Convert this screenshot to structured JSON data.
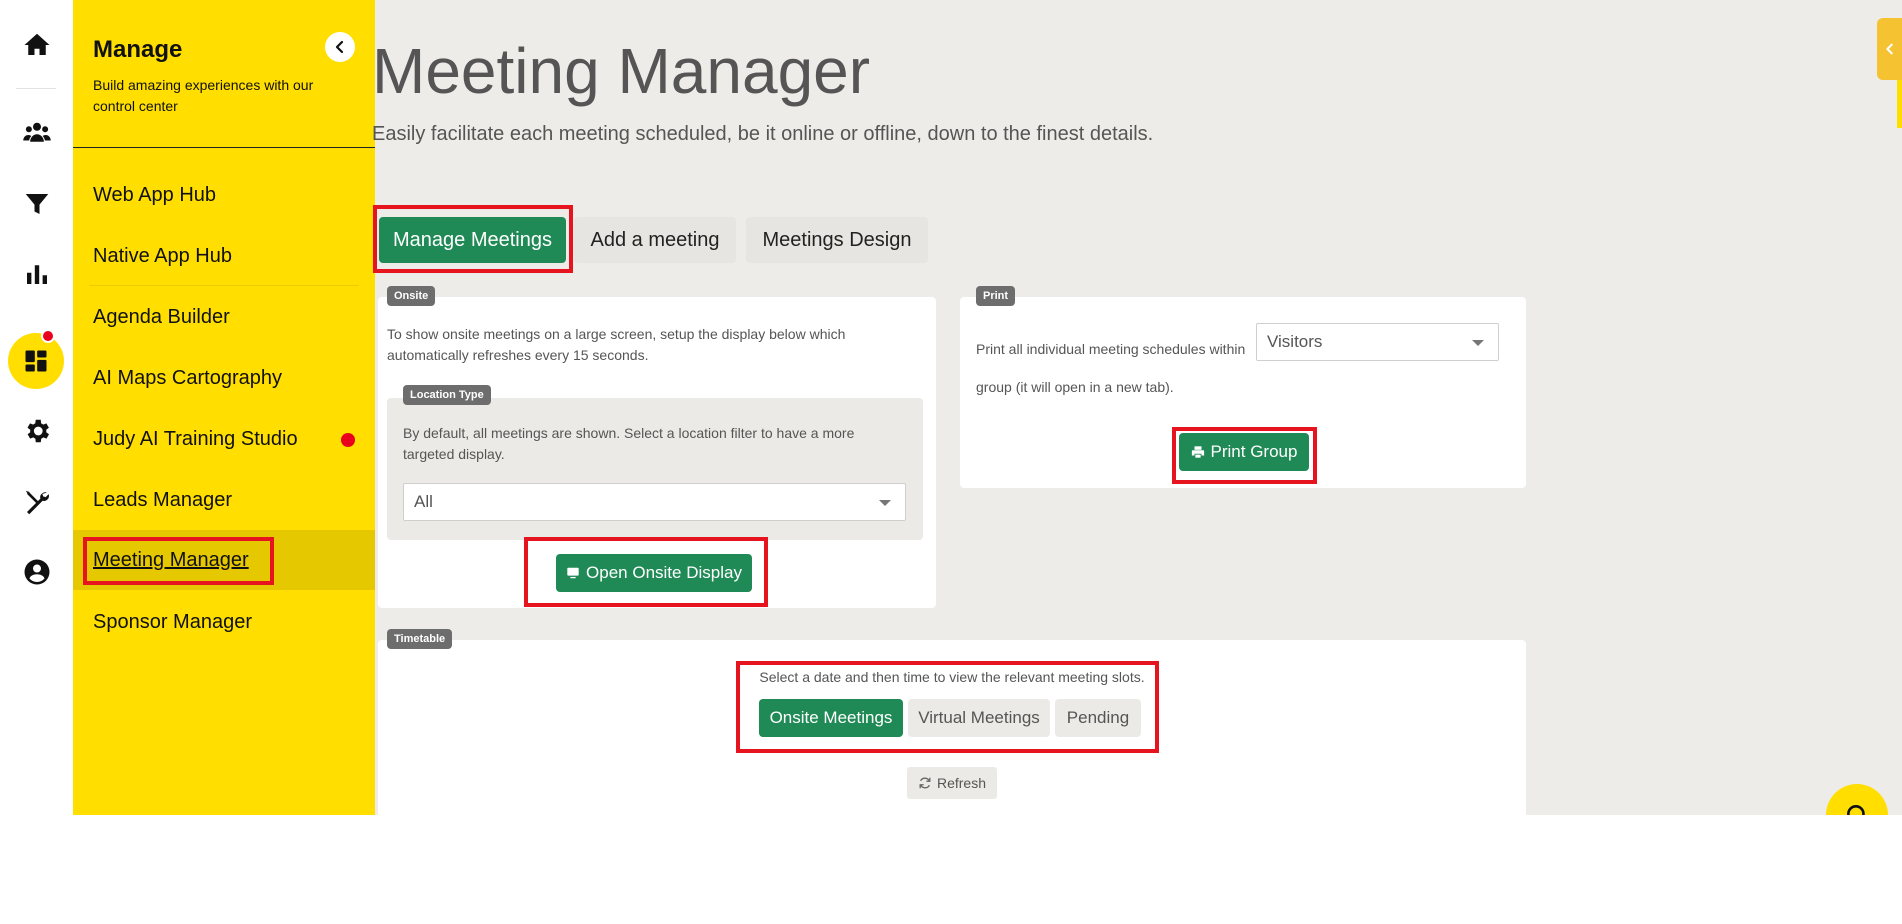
{
  "sidebar": {
    "title": "Manage",
    "subtitle": "Build amazing experiences with our control center",
    "items": [
      {
        "label": "Web App Hub"
      },
      {
        "label": "Native App Hub"
      },
      {
        "label": "Agenda Builder"
      },
      {
        "label": "AI Maps Cartography"
      },
      {
        "label": "Judy AI Training Studio",
        "has_notification": true
      },
      {
        "label": "Leads Manager"
      },
      {
        "label": "Meeting Manager",
        "active": true
      },
      {
        "label": "Sponsor Manager"
      }
    ]
  },
  "rail": {
    "icons": [
      "home-icon",
      "users-icon",
      "filter-icon",
      "bar-chart-icon",
      "dashboard-icon",
      "gear-icon",
      "tools-icon",
      "account-icon"
    ],
    "active": "dashboard-icon"
  },
  "header": {
    "title": "Meeting Manager",
    "subtitle": "Easily facilitate each meeting scheduled, be it online or offline, down to the finest details."
  },
  "tabs": [
    {
      "label": "Manage Meetings",
      "active": true
    },
    {
      "label": "Add a meeting"
    },
    {
      "label": "Meetings Design"
    }
  ],
  "onsite": {
    "badge": "Onsite",
    "description": "To show onsite meetings on a large screen, setup the display below which automatically refreshes every 15 seconds.",
    "location": {
      "badge": "Location Type",
      "description": "By default, all meetings are shown. Select a location filter to have a more targeted display.",
      "selected": "All"
    },
    "button": "Open Onsite Display"
  },
  "print": {
    "badge": "Print",
    "description": "Print all individual meeting schedules within group (it will open in a new tab).",
    "selected": "Visitors",
    "button": "Print Group"
  },
  "timetable": {
    "badge": "Timetable",
    "instruction": "Select a date and then time to view the relevant meeting slots.",
    "buttons": [
      {
        "label": "Onsite Meetings",
        "active": true
      },
      {
        "label": "Virtual Meetings"
      },
      {
        "label": "Pending"
      }
    ],
    "refresh": "Refresh"
  },
  "colors": {
    "brand_yellow": "#ffde00",
    "accent_green": "#1f8a55",
    "highlight_red": "#e5141f"
  }
}
